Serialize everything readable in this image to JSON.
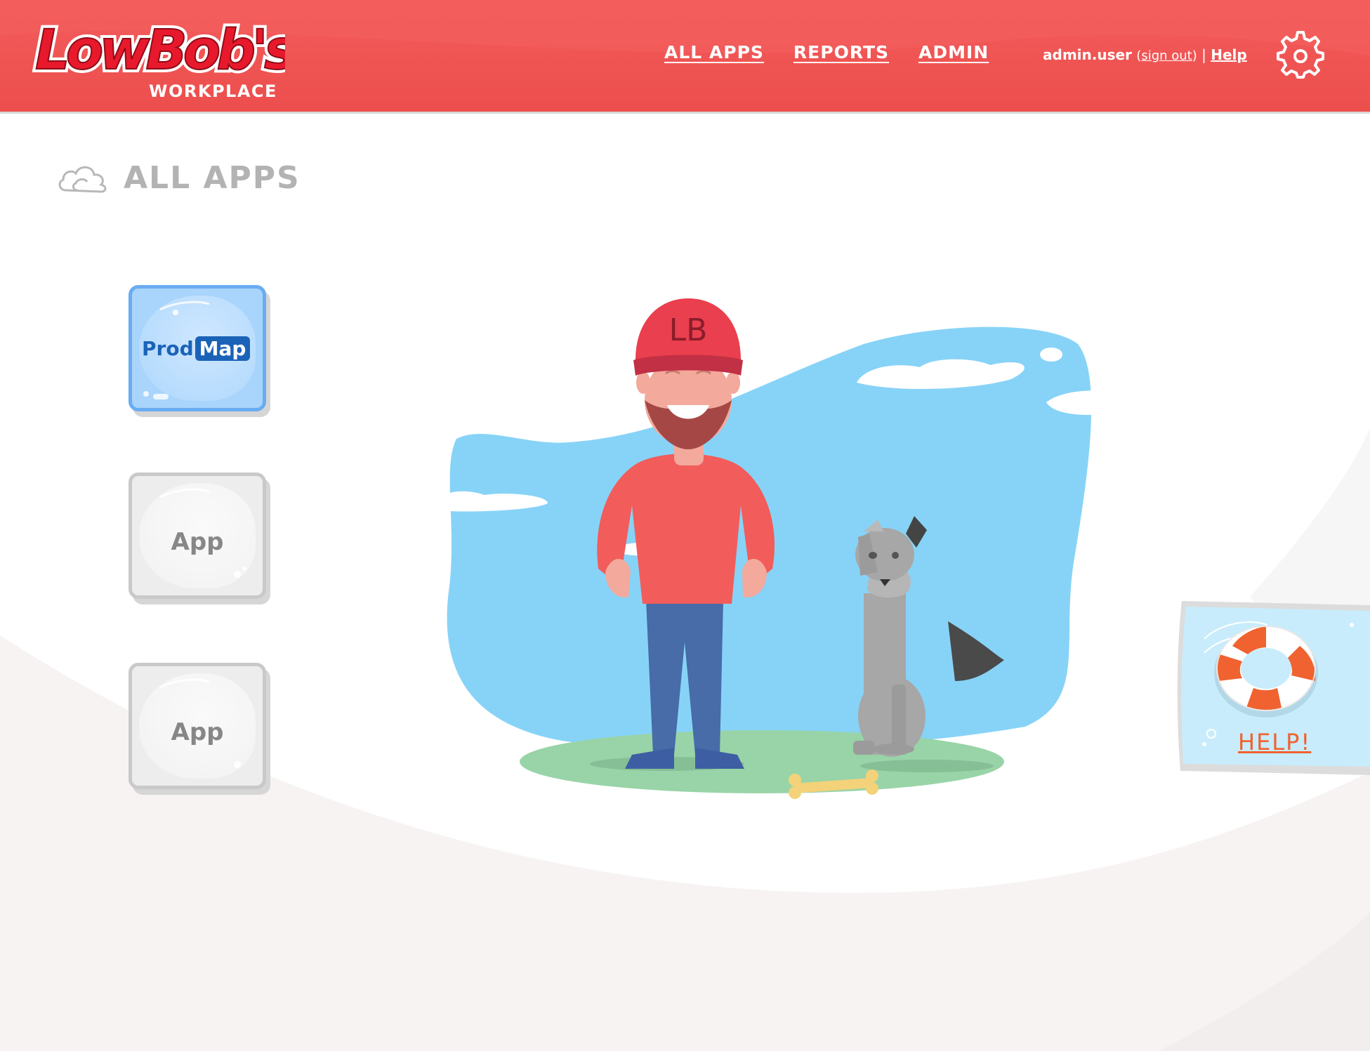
{
  "header": {
    "brand": "LowBob's",
    "brand_sub": "WORKPLACE",
    "nav": [
      "ALL APPS",
      "REPORTS",
      "ADMIN"
    ],
    "user": {
      "username": "admin.user",
      "sign_out": "sign out",
      "help": "Help"
    },
    "settings_icon": "gear-icon"
  },
  "page": {
    "title": "ALL APPS",
    "title_icon": "cloud-icon"
  },
  "apps": [
    {
      "label_part1": "Prod",
      "label_part2": "Map",
      "color": "#6aacf1"
    },
    {
      "label": "App",
      "color": "#c9c9c9"
    },
    {
      "label": "App",
      "color": "#c9c9c9"
    }
  ],
  "illustration": {
    "cap_text": "LB"
  },
  "help_card": {
    "label": "HELP!",
    "icon": "lifebuoy-icon"
  },
  "colors": {
    "brand_red": "#ec4e4c",
    "accent_blue": "#1a63b7",
    "help_orange": "#f0622f"
  }
}
